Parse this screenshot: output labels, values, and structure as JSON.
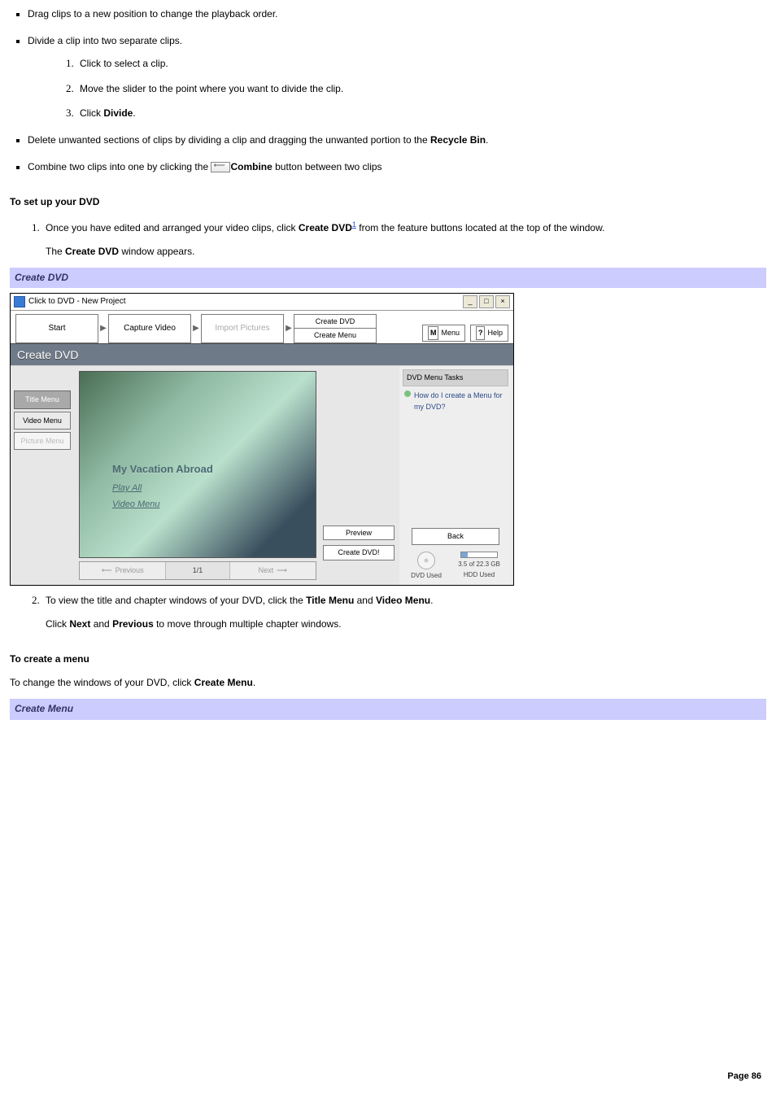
{
  "bullets": {
    "drag": "Drag clips to a new position to change the playback order.",
    "divide_lead": "Divide a clip into two separate clips.",
    "divide_steps": {
      "s1": "Click to select a clip.",
      "s2": "Move the slider to the point where you want to divide the clip.",
      "s3_a": "Click ",
      "s3_b": "Divide",
      "s3_c": "."
    },
    "delete_a": "Delete unwanted sections of clips by dividing a clip and dragging the unwanted portion to the ",
    "delete_b": "Recycle Bin",
    "delete_c": ".",
    "combine_a": "Combine two clips into one by clicking the ",
    "combine_b": "Combine",
    "combine_c": " button between two clips"
  },
  "sec_setup": {
    "heading": "To set up your DVD",
    "step1_a": "Once you have edited and arranged your video clips, click ",
    "step1_b": "Create DVD",
    "step1_sup": "1",
    "step1_c": " from the feature buttons located at the top of the window.",
    "after_a": "The ",
    "after_b": "Create DVD",
    "after_c": " window appears."
  },
  "cap1": "Create DVD",
  "shot": {
    "title": "Click to DVD - New Project",
    "steps": {
      "start": "Start",
      "capture": "Capture Video",
      "import": "Import Pictures",
      "create_dvd": "Create DVD",
      "create_menu": "Create Menu"
    },
    "menu_btn": "Menu",
    "menu_tag": "M",
    "help_btn": "Help",
    "help_tag": "?",
    "section": "Create DVD",
    "tabs": {
      "title": "Title Menu",
      "video": "Video Menu",
      "picture": "Picture Menu"
    },
    "overlay": {
      "title": "My Vacation Abroad",
      "play": "Play All",
      "vmenu": "Video Menu"
    },
    "pager": {
      "prev": "Previous",
      "count": "1/1",
      "next": "Next"
    },
    "side": {
      "preview": "Preview",
      "create": "Create DVD!"
    },
    "tasks_head": "DVD Menu Tasks",
    "task1": "How do I create a Menu for my DVD?",
    "back": "Back",
    "dvd_used": "DVD Used",
    "hdd_amount": "3.5 of 22.3 GB",
    "hdd_used": "HDD Used"
  },
  "sec_setup2": {
    "step2_a": "To view the title and chapter windows of your DVD, click the ",
    "step2_b": "Title Menu",
    "step2_c": " and ",
    "step2_d": "Video Menu",
    "step2_e": ".",
    "after_a": "Click ",
    "after_b": "Next",
    "after_c": " and ",
    "after_d": "Previous",
    "after_e": " to move through multiple chapter windows."
  },
  "sec_menu": {
    "heading": "To create a menu",
    "lead_a": "To change the windows of your DVD, click ",
    "lead_b": "Create Menu",
    "lead_c": "."
  },
  "cap2": "Create Menu",
  "page": "Page 86"
}
